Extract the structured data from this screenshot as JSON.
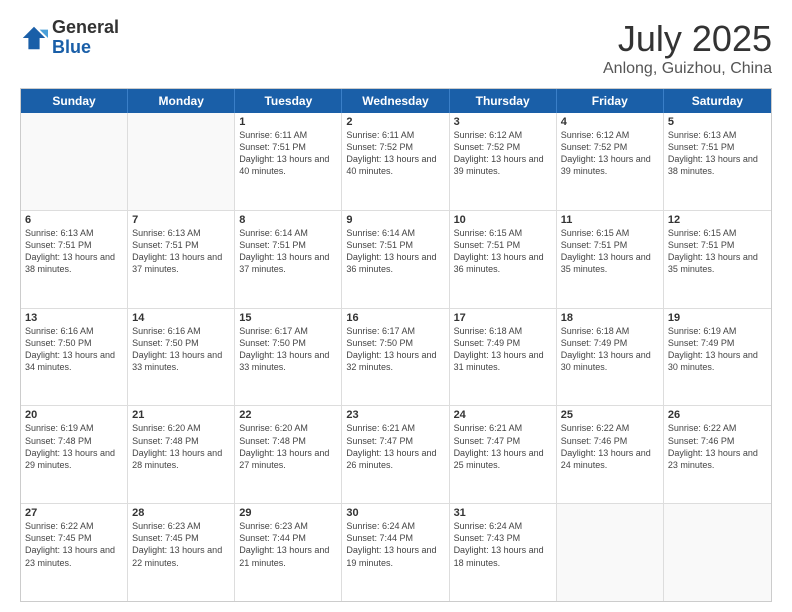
{
  "logo": {
    "general": "General",
    "blue": "Blue"
  },
  "title": "July 2025",
  "location": "Anlong, Guizhou, China",
  "header_days": [
    "Sunday",
    "Monday",
    "Tuesday",
    "Wednesday",
    "Thursday",
    "Friday",
    "Saturday"
  ],
  "weeks": [
    [
      {
        "day": "",
        "info": ""
      },
      {
        "day": "",
        "info": ""
      },
      {
        "day": "1",
        "info": "Sunrise: 6:11 AM\nSunset: 7:51 PM\nDaylight: 13 hours and 40 minutes."
      },
      {
        "day": "2",
        "info": "Sunrise: 6:11 AM\nSunset: 7:52 PM\nDaylight: 13 hours and 40 minutes."
      },
      {
        "day": "3",
        "info": "Sunrise: 6:12 AM\nSunset: 7:52 PM\nDaylight: 13 hours and 39 minutes."
      },
      {
        "day": "4",
        "info": "Sunrise: 6:12 AM\nSunset: 7:52 PM\nDaylight: 13 hours and 39 minutes."
      },
      {
        "day": "5",
        "info": "Sunrise: 6:13 AM\nSunset: 7:51 PM\nDaylight: 13 hours and 38 minutes."
      }
    ],
    [
      {
        "day": "6",
        "info": "Sunrise: 6:13 AM\nSunset: 7:51 PM\nDaylight: 13 hours and 38 minutes."
      },
      {
        "day": "7",
        "info": "Sunrise: 6:13 AM\nSunset: 7:51 PM\nDaylight: 13 hours and 37 minutes."
      },
      {
        "day": "8",
        "info": "Sunrise: 6:14 AM\nSunset: 7:51 PM\nDaylight: 13 hours and 37 minutes."
      },
      {
        "day": "9",
        "info": "Sunrise: 6:14 AM\nSunset: 7:51 PM\nDaylight: 13 hours and 36 minutes."
      },
      {
        "day": "10",
        "info": "Sunrise: 6:15 AM\nSunset: 7:51 PM\nDaylight: 13 hours and 36 minutes."
      },
      {
        "day": "11",
        "info": "Sunrise: 6:15 AM\nSunset: 7:51 PM\nDaylight: 13 hours and 35 minutes."
      },
      {
        "day": "12",
        "info": "Sunrise: 6:15 AM\nSunset: 7:51 PM\nDaylight: 13 hours and 35 minutes."
      }
    ],
    [
      {
        "day": "13",
        "info": "Sunrise: 6:16 AM\nSunset: 7:50 PM\nDaylight: 13 hours and 34 minutes."
      },
      {
        "day": "14",
        "info": "Sunrise: 6:16 AM\nSunset: 7:50 PM\nDaylight: 13 hours and 33 minutes."
      },
      {
        "day": "15",
        "info": "Sunrise: 6:17 AM\nSunset: 7:50 PM\nDaylight: 13 hours and 33 minutes."
      },
      {
        "day": "16",
        "info": "Sunrise: 6:17 AM\nSunset: 7:50 PM\nDaylight: 13 hours and 32 minutes."
      },
      {
        "day": "17",
        "info": "Sunrise: 6:18 AM\nSunset: 7:49 PM\nDaylight: 13 hours and 31 minutes."
      },
      {
        "day": "18",
        "info": "Sunrise: 6:18 AM\nSunset: 7:49 PM\nDaylight: 13 hours and 30 minutes."
      },
      {
        "day": "19",
        "info": "Sunrise: 6:19 AM\nSunset: 7:49 PM\nDaylight: 13 hours and 30 minutes."
      }
    ],
    [
      {
        "day": "20",
        "info": "Sunrise: 6:19 AM\nSunset: 7:48 PM\nDaylight: 13 hours and 29 minutes."
      },
      {
        "day": "21",
        "info": "Sunrise: 6:20 AM\nSunset: 7:48 PM\nDaylight: 13 hours and 28 minutes."
      },
      {
        "day": "22",
        "info": "Sunrise: 6:20 AM\nSunset: 7:48 PM\nDaylight: 13 hours and 27 minutes."
      },
      {
        "day": "23",
        "info": "Sunrise: 6:21 AM\nSunset: 7:47 PM\nDaylight: 13 hours and 26 minutes."
      },
      {
        "day": "24",
        "info": "Sunrise: 6:21 AM\nSunset: 7:47 PM\nDaylight: 13 hours and 25 minutes."
      },
      {
        "day": "25",
        "info": "Sunrise: 6:22 AM\nSunset: 7:46 PM\nDaylight: 13 hours and 24 minutes."
      },
      {
        "day": "26",
        "info": "Sunrise: 6:22 AM\nSunset: 7:46 PM\nDaylight: 13 hours and 23 minutes."
      }
    ],
    [
      {
        "day": "27",
        "info": "Sunrise: 6:22 AM\nSunset: 7:45 PM\nDaylight: 13 hours and 23 minutes."
      },
      {
        "day": "28",
        "info": "Sunrise: 6:23 AM\nSunset: 7:45 PM\nDaylight: 13 hours and 22 minutes."
      },
      {
        "day": "29",
        "info": "Sunrise: 6:23 AM\nSunset: 7:44 PM\nDaylight: 13 hours and 21 minutes."
      },
      {
        "day": "30",
        "info": "Sunrise: 6:24 AM\nSunset: 7:44 PM\nDaylight: 13 hours and 19 minutes."
      },
      {
        "day": "31",
        "info": "Sunrise: 6:24 AM\nSunset: 7:43 PM\nDaylight: 13 hours and 18 minutes."
      },
      {
        "day": "",
        "info": ""
      },
      {
        "day": "",
        "info": ""
      }
    ]
  ]
}
